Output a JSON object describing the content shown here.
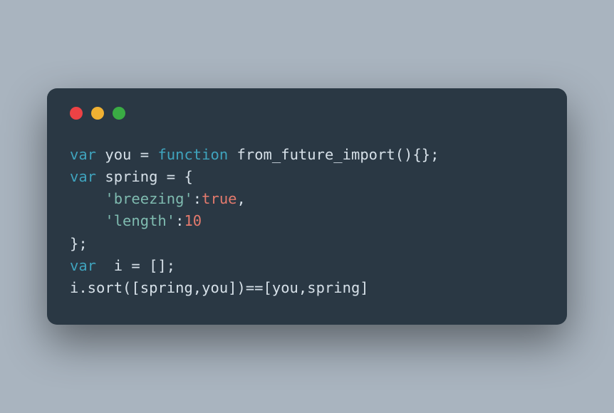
{
  "window": {
    "dots": [
      "red",
      "yellow",
      "green"
    ]
  },
  "code": {
    "tokens": [
      [
        {
          "t": "var ",
          "c": "kw"
        },
        {
          "t": "you ",
          "c": "ident"
        },
        {
          "t": "= ",
          "c": "punct"
        },
        {
          "t": "function ",
          "c": "kw"
        },
        {
          "t": "from_future_import",
          "c": "fn"
        },
        {
          "t": "(){};",
          "c": "punct"
        }
      ],
      [
        {
          "t": "var ",
          "c": "kw"
        },
        {
          "t": "spring ",
          "c": "ident"
        },
        {
          "t": "= {",
          "c": "punct"
        }
      ],
      [
        {
          "t": "    ",
          "c": "punct"
        },
        {
          "t": "'breezing'",
          "c": "str"
        },
        {
          "t": ":",
          "c": "punct"
        },
        {
          "t": "true",
          "c": "bool"
        },
        {
          "t": ",",
          "c": "punct"
        }
      ],
      [
        {
          "t": "    ",
          "c": "punct"
        },
        {
          "t": "'length'",
          "c": "str"
        },
        {
          "t": ":",
          "c": "punct"
        },
        {
          "t": "10",
          "c": "num"
        }
      ],
      [
        {
          "t": "};",
          "c": "punct"
        }
      ],
      [
        {
          "t": "var  ",
          "c": "kw"
        },
        {
          "t": "i ",
          "c": "ident"
        },
        {
          "t": "= [];",
          "c": "punct"
        }
      ],
      [
        {
          "t": "i.sort([spring,you])==[you,spring]",
          "c": "ident"
        }
      ]
    ]
  }
}
